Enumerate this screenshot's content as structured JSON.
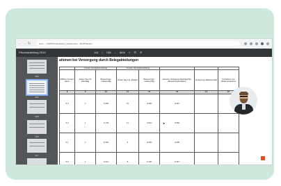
{
  "browser": {
    "url": "www.... /pdf/Pfluchtanleitung_Verbraucher.../2019?ifaction",
    "back_icon": "arrow-left-icon",
    "forward_icon": "arrow-right-icon",
    "reload_icon": "reload-icon"
  },
  "pdf_viewer": {
    "title": "Pfluchtanleitung 2019",
    "page_current": "114",
    "page_separator": "/",
    "page_total": "136",
    "zoom": "84%",
    "zoom_minus": "–",
    "zoom_plus": "+"
  },
  "sidebar": {
    "thumbnails": [
      {
        "label": "102",
        "selected": false
      },
      {
        "label": "114",
        "selected": true
      },
      {
        "label": "115",
        "selected": false
      },
      {
        "label": "116",
        "selected": false
      },
      {
        "label": "117",
        "selected": false
      },
      {
        "label": "118",
        "selected": false
      }
    ]
  },
  "document": {
    "heading": "ationen bei Versorgung durch Belegabteilungen",
    "group_headers": [
      "Lineare Verlustbetrachtung",
      "Lineare Verlustbetrachtung"
    ],
    "col_headers": [
      "Mittlere Verweil-dauer",
      "Erster Tag mit Abschlag",
      "Bewertungs-relation/Tag",
      "Erster Tag zus. Entgelt",
      "Bewertungs-relation/Tag",
      "Externe Verlegung Abschlag/Tag (Bewertungsrelation)",
      "Verlegungs-fallpauschale",
      "Ausnahme von Wiederaufnahme"
    ],
    "col_numbers": [
      "8",
      "9",
      "10",
      "11",
      "12",
      "13",
      "14",
      "15"
    ],
    "rows": [
      [
        "3,0",
        "1",
        "0,289",
        "10",
        "0,084",
        "0,087",
        "",
        ""
      ],
      [
        "4,3",
        "1",
        "0,178",
        "11",
        "0,044",
        "0,059",
        "",
        ""
      ],
      [
        "2,1",
        "1",
        "0,302",
        "4",
        "0,293",
        "0,205",
        "",
        ""
      ],
      [
        "3,5",
        "1",
        "0,211",
        "8",
        "0,103",
        "0,167",
        "",
        ""
      ]
    ]
  }
}
